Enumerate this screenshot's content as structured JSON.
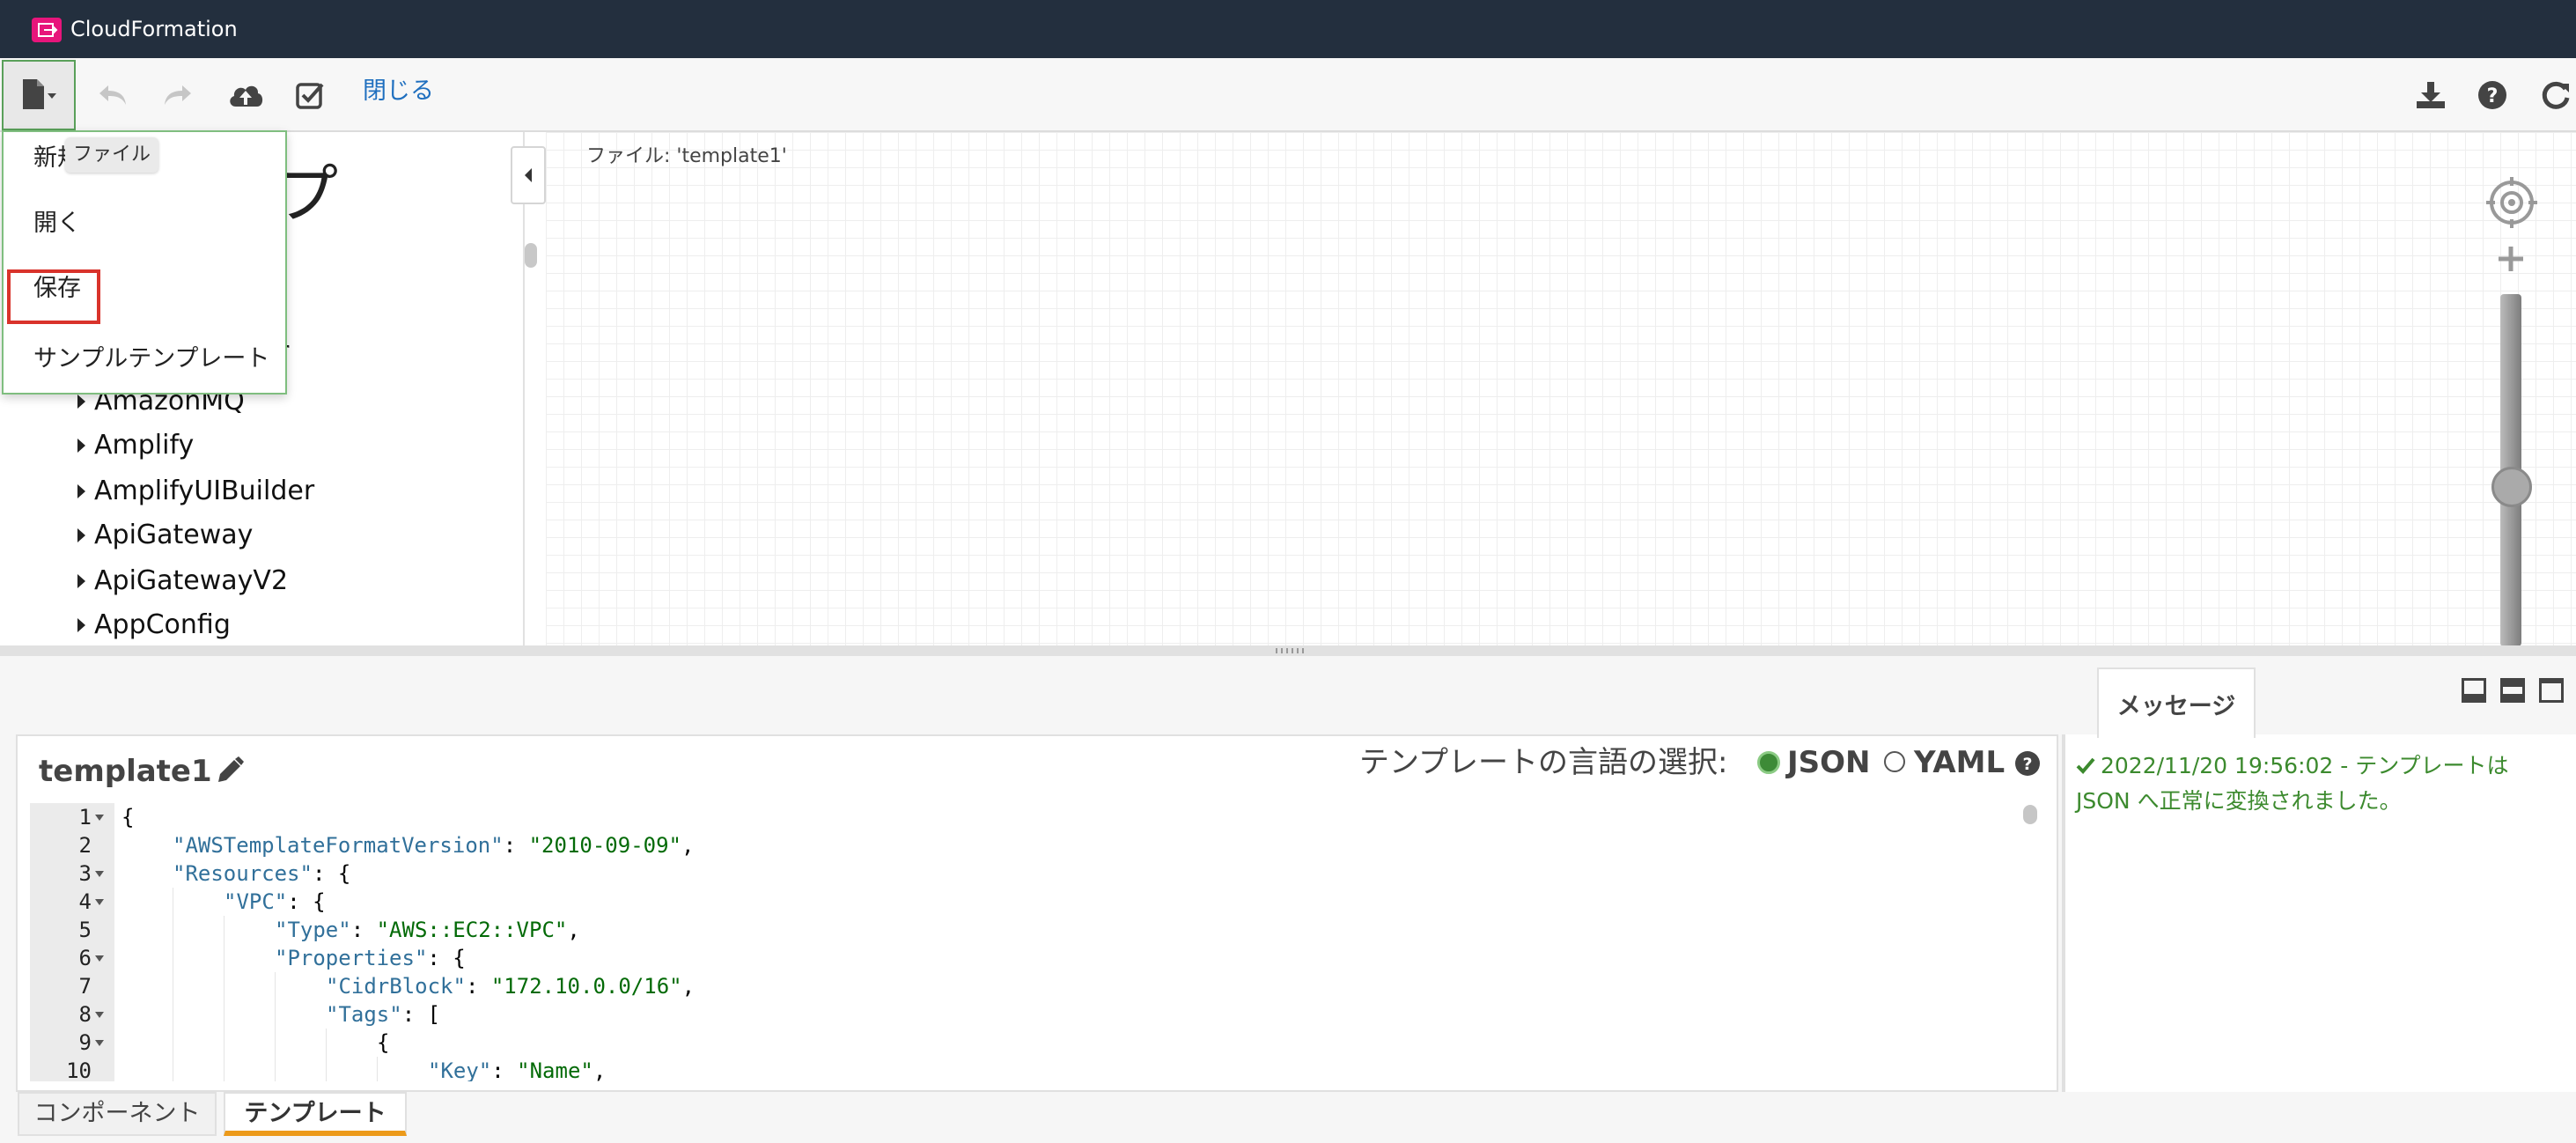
{
  "app": {
    "title": "CloudFormation",
    "brand_color": "#e7157b",
    "topbar_color": "#232f3e"
  },
  "toolbar": {
    "close_label": "閉じる"
  },
  "file_menu": {
    "tooltip": "ファイル",
    "items": [
      "新規",
      "開く",
      "保存",
      "サンプルテンプレート"
    ],
    "highlighted_item": "保存"
  },
  "left_panel": {
    "title_partial": "イプ",
    "partial_item": "r",
    "items": [
      "AmazonMQ",
      "Amplify",
      "AmplifyUIBuilder",
      "ApiGateway",
      "ApiGatewayV2",
      "AppConfig"
    ]
  },
  "canvas": {
    "file_label": "ファイル: 'template1'"
  },
  "editor": {
    "template_name": "template1",
    "language_label": "テンプレートの言語の選択:",
    "json_label": "JSON",
    "yaml_label": "YAML",
    "selected_language": "JSON",
    "lines": [
      {
        "n": "1",
        "fold": true,
        "indent": 0,
        "parts": [
          [
            "p",
            "{"
          ]
        ]
      },
      {
        "n": "2",
        "fold": false,
        "indent": 1,
        "parts": [
          [
            "k",
            "\"AWSTemplateFormatVersion\""
          ],
          [
            "p",
            ": "
          ],
          [
            "s",
            "\"2010-09-09\""
          ],
          [
            "p",
            ","
          ]
        ]
      },
      {
        "n": "3",
        "fold": true,
        "indent": 1,
        "parts": [
          [
            "k",
            "\"Resources\""
          ],
          [
            "p",
            ": {"
          ]
        ]
      },
      {
        "n": "4",
        "fold": true,
        "indent": 2,
        "parts": [
          [
            "k",
            "\"VPC\""
          ],
          [
            "p",
            ": {"
          ]
        ]
      },
      {
        "n": "5",
        "fold": false,
        "indent": 3,
        "parts": [
          [
            "k",
            "\"Type\""
          ],
          [
            "p",
            ": "
          ],
          [
            "s",
            "\"AWS::EC2::VPC\""
          ],
          [
            "p",
            ","
          ]
        ]
      },
      {
        "n": "6",
        "fold": true,
        "indent": 3,
        "parts": [
          [
            "k",
            "\"Properties\""
          ],
          [
            "p",
            ": {"
          ]
        ]
      },
      {
        "n": "7",
        "fold": false,
        "indent": 4,
        "parts": [
          [
            "k",
            "\"CidrBlock\""
          ],
          [
            "p",
            ": "
          ],
          [
            "s",
            "\"172.10.0.0/16\""
          ],
          [
            "p",
            ","
          ]
        ]
      },
      {
        "n": "8",
        "fold": true,
        "indent": 4,
        "parts": [
          [
            "k",
            "\"Tags\""
          ],
          [
            "p",
            ": ["
          ]
        ]
      },
      {
        "n": "9",
        "fold": true,
        "indent": 5,
        "parts": [
          [
            "p",
            "{"
          ]
        ]
      },
      {
        "n": "10",
        "fold": false,
        "indent": 6,
        "parts": [
          [
            "k",
            "\"Key\""
          ],
          [
            "p",
            ": "
          ],
          [
            "s",
            "\"Name\""
          ],
          [
            "p",
            ","
          ]
        ]
      }
    ]
  },
  "messages": {
    "tab_label": "メッセージ",
    "text": "2022/11/20 19:56:02 - テンプレートは JSON へ正常に変換されました。"
  },
  "bottom_tabs": {
    "components": "コンポーネント",
    "template": "テンプレート",
    "active": "テンプレート"
  }
}
